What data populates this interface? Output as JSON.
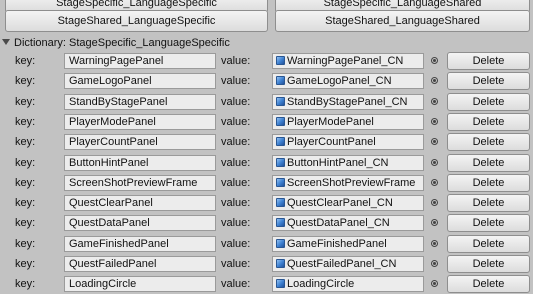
{
  "top_buttons": {
    "left_label": "StageSpecific_LanguageSpecific",
    "right_label": "StageSpecific_LanguageShared"
  },
  "mid_buttons": {
    "left_label": "StageShared_LanguageSpecific",
    "right_label": "StageShared_LanguageShared"
  },
  "dictionary": {
    "header": "Dictionary: StageSpecific_LanguageSpecific",
    "key_label": "key:",
    "value_label": "value:",
    "delete_label": "Delete",
    "value_icon": "prefab-cube-icon",
    "picker_icon": "object-picker-icon",
    "entries": [
      {
        "key": "WarningPagePanel",
        "value": "WarningPagePanel_CN"
      },
      {
        "key": "GameLogoPanel",
        "value": "GameLogoPanel_CN"
      },
      {
        "key": "StandByStagePanel",
        "value": "StandByStagePanel_CN"
      },
      {
        "key": "PlayerModePanel",
        "value": "PlayerModePanel"
      },
      {
        "key": "PlayerCountPanel",
        "value": "PlayerCountPanel"
      },
      {
        "key": "ButtonHintPanel",
        "value": "ButtonHintPanel_CN"
      },
      {
        "key": "ScreenShotPreviewFrame",
        "value": "ScreenShotPreviewFrame"
      },
      {
        "key": "QuestClearPanel",
        "value": "QuestClearPanel_CN"
      },
      {
        "key": "QuestDataPanel",
        "value": "QuestDataPanel_CN"
      },
      {
        "key": "GameFinishedPanel",
        "value": "GameFinishedPanel"
      },
      {
        "key": "QuestFailedPanel",
        "value": "QuestFailedPanel_CN"
      },
      {
        "key": "LoadingCircle",
        "value": "LoadingCircle"
      }
    ]
  }
}
